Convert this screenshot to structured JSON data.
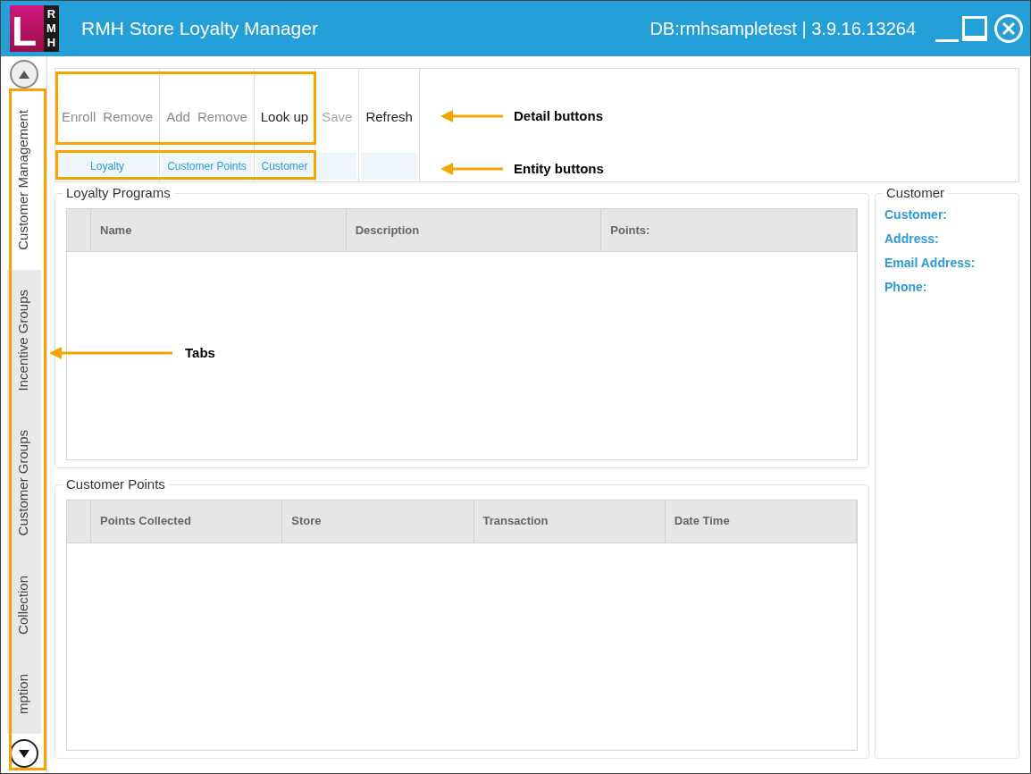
{
  "window": {
    "title": "RMH Store Loyalty Manager",
    "info": "DB:rmhsampletest | 3.9.16.13264",
    "logo": {
      "letter": "L",
      "side": [
        "R",
        "M",
        "H"
      ]
    }
  },
  "tabs": [
    {
      "label": "Customer Management",
      "selected": true
    },
    {
      "label": "Incentive Groups",
      "selected": false
    },
    {
      "label": "Customer Groups",
      "selected": false
    },
    {
      "label": "Collection",
      "selected": false
    },
    {
      "label": "mption",
      "selected": false
    }
  ],
  "toolbar": {
    "groups": [
      {
        "buttons": [
          {
            "label": "Enroll",
            "disabled": true
          },
          {
            "label": "Remove",
            "disabled": true
          }
        ],
        "entity": "Loyalty"
      },
      {
        "buttons": [
          {
            "label": "Add",
            "disabled": true
          },
          {
            "label": "Remove",
            "disabled": true
          }
        ],
        "entity": "Customer Points"
      },
      {
        "buttons": [
          {
            "label": "Look up",
            "disabled": false
          }
        ],
        "entity": "Customer"
      },
      {
        "buttons": [
          {
            "label": "Save",
            "disabled": true
          }
        ]
      },
      {
        "buttons": [
          {
            "label": "Refresh",
            "disabled": false
          }
        ]
      }
    ]
  },
  "loyalty_programs": {
    "title": "Loyalty Programs",
    "columns": [
      "Name",
      "Description",
      "Points:"
    ]
  },
  "customer_points": {
    "title": "Customer Points",
    "columns": [
      "Points Collected",
      "Store",
      "Transaction",
      "Date Time"
    ]
  },
  "customer": {
    "title": "Customer",
    "fields": [
      "Customer:",
      "Address:",
      "Email Address:",
      "Phone:"
    ]
  },
  "annotations": [
    {
      "label": "Detail buttons"
    },
    {
      "label": "Entity buttons"
    },
    {
      "label": "Tabs"
    }
  ]
}
